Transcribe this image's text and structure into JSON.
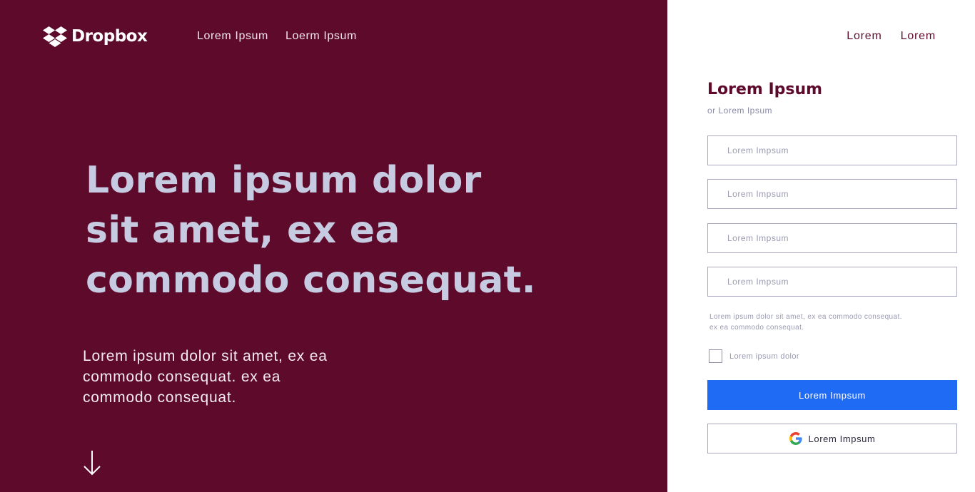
{
  "header": {
    "logo_text": "Dropbox",
    "logo_icon": "dropbox-box-icon",
    "nav_left": [
      "Lorem Ipsum",
      "Loerm Ipsum"
    ],
    "nav_right": [
      "Lorem",
      "Lorem"
    ]
  },
  "hero": {
    "title": "Lorem ipsum dolor sit amet, ex ea commodo consequat.",
    "subtitle": "Lorem ipsum dolor sit amet, ex ea commodo consequat. ex ea commodo consequat.",
    "scroll_icon": "arrow-down-icon"
  },
  "form": {
    "title": "Lorem Ipsum",
    "subtitle": "or Lorem Ipsum",
    "fields": [
      {
        "placeholder": "Lorem Impsum",
        "value": ""
      },
      {
        "placeholder": "Lorem Impsum",
        "value": ""
      },
      {
        "placeholder": "Lorem Impsum",
        "value": ""
      },
      {
        "placeholder": "Lorem Impsum",
        "value": ""
      }
    ],
    "legal": "Lorem ipsum dolor sit amet, ex ea commodo consequat. ex ea commodo consequat.",
    "checkbox_label": "Lorem ipsum dolor",
    "checkbox_checked": false,
    "submit_label": "Lorem Impsum",
    "google_label": "Lorem Impsum",
    "google_icon": "google-g-icon"
  },
  "colors": {
    "brand_background": "#5e0b2b",
    "hero_title": "#c6cbe2",
    "primary_button": "#1f6bf4"
  }
}
